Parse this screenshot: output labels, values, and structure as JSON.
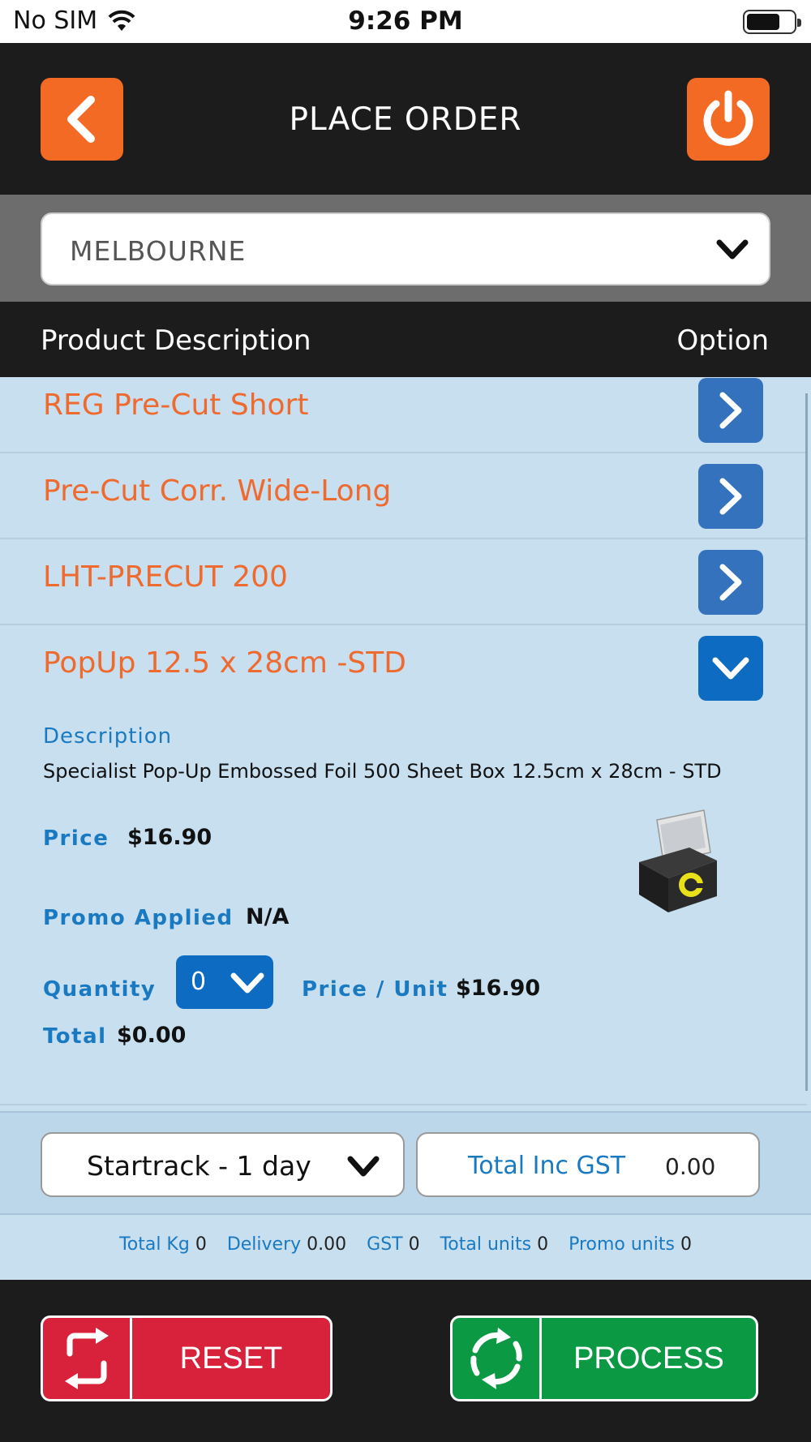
{
  "status_bar": {
    "carrier": "No SIM",
    "time": "9:26 PM"
  },
  "header": {
    "title": "PLACE ORDER"
  },
  "location": {
    "selected": "MELBOURNE"
  },
  "columns": {
    "left": "Product Description",
    "right": "Option"
  },
  "products": [
    {
      "name": "REG Pre-Cut Short"
    },
    {
      "name": "Pre-Cut Corr. Wide-Long"
    },
    {
      "name": "LHT-PRECUT 200"
    },
    {
      "name": "PopUp 12.5 x 28cm -STD"
    }
  ],
  "detail": {
    "description_label": "Description",
    "description": "Specialist Pop-Up Embossed Foil 500 Sheet Box 12.5cm x 28cm - STD",
    "price_label": "Price",
    "price": "$16.90",
    "promo_label": "Promo Applied",
    "promo": "N/A",
    "quantity_label": "Quantity",
    "quantity": "0",
    "price_unit_label": "Price / Unit",
    "price_unit": "$16.90",
    "total_label": "Total",
    "total": "$0.00"
  },
  "shipping": {
    "method": "Startrack - 1 day",
    "total_gst_label": "Total Inc GST",
    "total_gst": "0.00"
  },
  "summary": {
    "total_kg_label": "Total Kg",
    "total_kg": "0",
    "delivery_label": "Delivery",
    "delivery": "0.00",
    "gst_label": "GST",
    "gst": "0",
    "total_units_label": "Total units",
    "total_units": "0",
    "promo_units_label": "Promo units",
    "promo_units": "0"
  },
  "buttons": {
    "reset": "RESET",
    "process": "PROCESS"
  },
  "colors": {
    "accent_orange": "#f26a24",
    "list_bg": "#c8dff0",
    "link_blue": "#1a7ac1",
    "reset_red": "#d8213a",
    "process_green": "#0b9944"
  },
  "icons": [
    "wifi-icon",
    "battery-icon",
    "back-chevron-icon",
    "power-icon",
    "chevron-down-icon",
    "chevron-right-icon",
    "reset-icon",
    "process-icon"
  ]
}
